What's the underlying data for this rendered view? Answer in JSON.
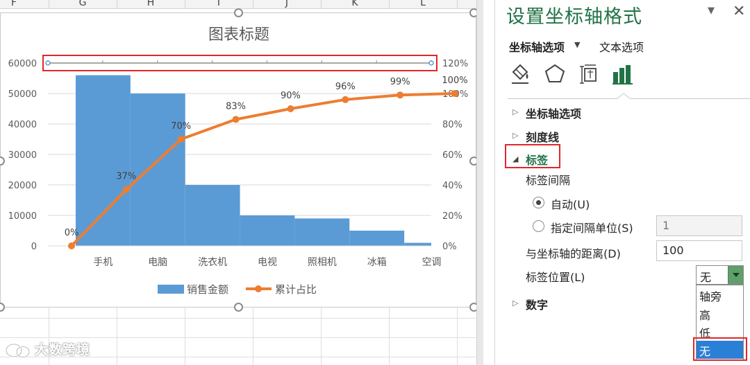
{
  "sheet": {
    "columns": [
      "F",
      "G",
      "H",
      "I",
      "J",
      "K",
      "L"
    ]
  },
  "chart_data": {
    "type": "bar",
    "title": "图表标题",
    "categories": [
      "手机",
      "电脑",
      "洗衣机",
      "电视",
      "照相机",
      "冰箱",
      "空调"
    ],
    "series": [
      {
        "name": "销售金额",
        "type": "bar",
        "axis": "left",
        "color": "#5b9bd5",
        "values": [
          56000,
          50000,
          20000,
          10000,
          9000,
          5000,
          1000
        ]
      },
      {
        "name": "累计占比",
        "type": "line",
        "axis": "right",
        "color": "#ed7d31",
        "x": [
          0,
          1,
          2,
          3,
          4,
          5,
          6,
          7
        ],
        "values": [
          0,
          37,
          70,
          83,
          90,
          96,
          99,
          100
        ],
        "data_labels": [
          "0%",
          "37%",
          "70%",
          "83%",
          "90%",
          "96%",
          "99%",
          "100%"
        ]
      }
    ],
    "y_left": {
      "ylim": [
        0,
        60000
      ],
      "ticks": [
        "0",
        "10000",
        "20000",
        "30000",
        "40000",
        "50000",
        "60000"
      ]
    },
    "y_right": {
      "ylim": [
        0,
        120
      ],
      "ticks": [
        "0%",
        "20%",
        "40%",
        "60%",
        "80%",
        "100%",
        "120%"
      ]
    },
    "grid": true,
    "legend": "bottom"
  },
  "watermark": {
    "text": "大数跨境"
  },
  "pane": {
    "title": "设置坐标轴格式",
    "tabs": {
      "axis_options": "坐标轴选项",
      "text_options": "文本选项"
    },
    "icons": [
      "fill-line-icon",
      "effects-pentagon-icon",
      "size-properties-icon",
      "axis-options-bar-icon"
    ],
    "sections": {
      "axis_options": "坐标轴选项",
      "tick_marks": "刻度线",
      "labels": "标签",
      "number": "数字"
    },
    "labels": {
      "interval_label": "标签间隔",
      "auto_label": "自动(U)",
      "specify_label": "指定间隔单位(S)",
      "specify_value": "1",
      "distance_label": "与坐标轴的距离(D)",
      "distance_value": "100",
      "position_label": "标签位置(L)",
      "position_value": "无",
      "position_options": [
        "轴旁",
        "高",
        "低",
        "无"
      ]
    },
    "accent_color": "#217346"
  }
}
